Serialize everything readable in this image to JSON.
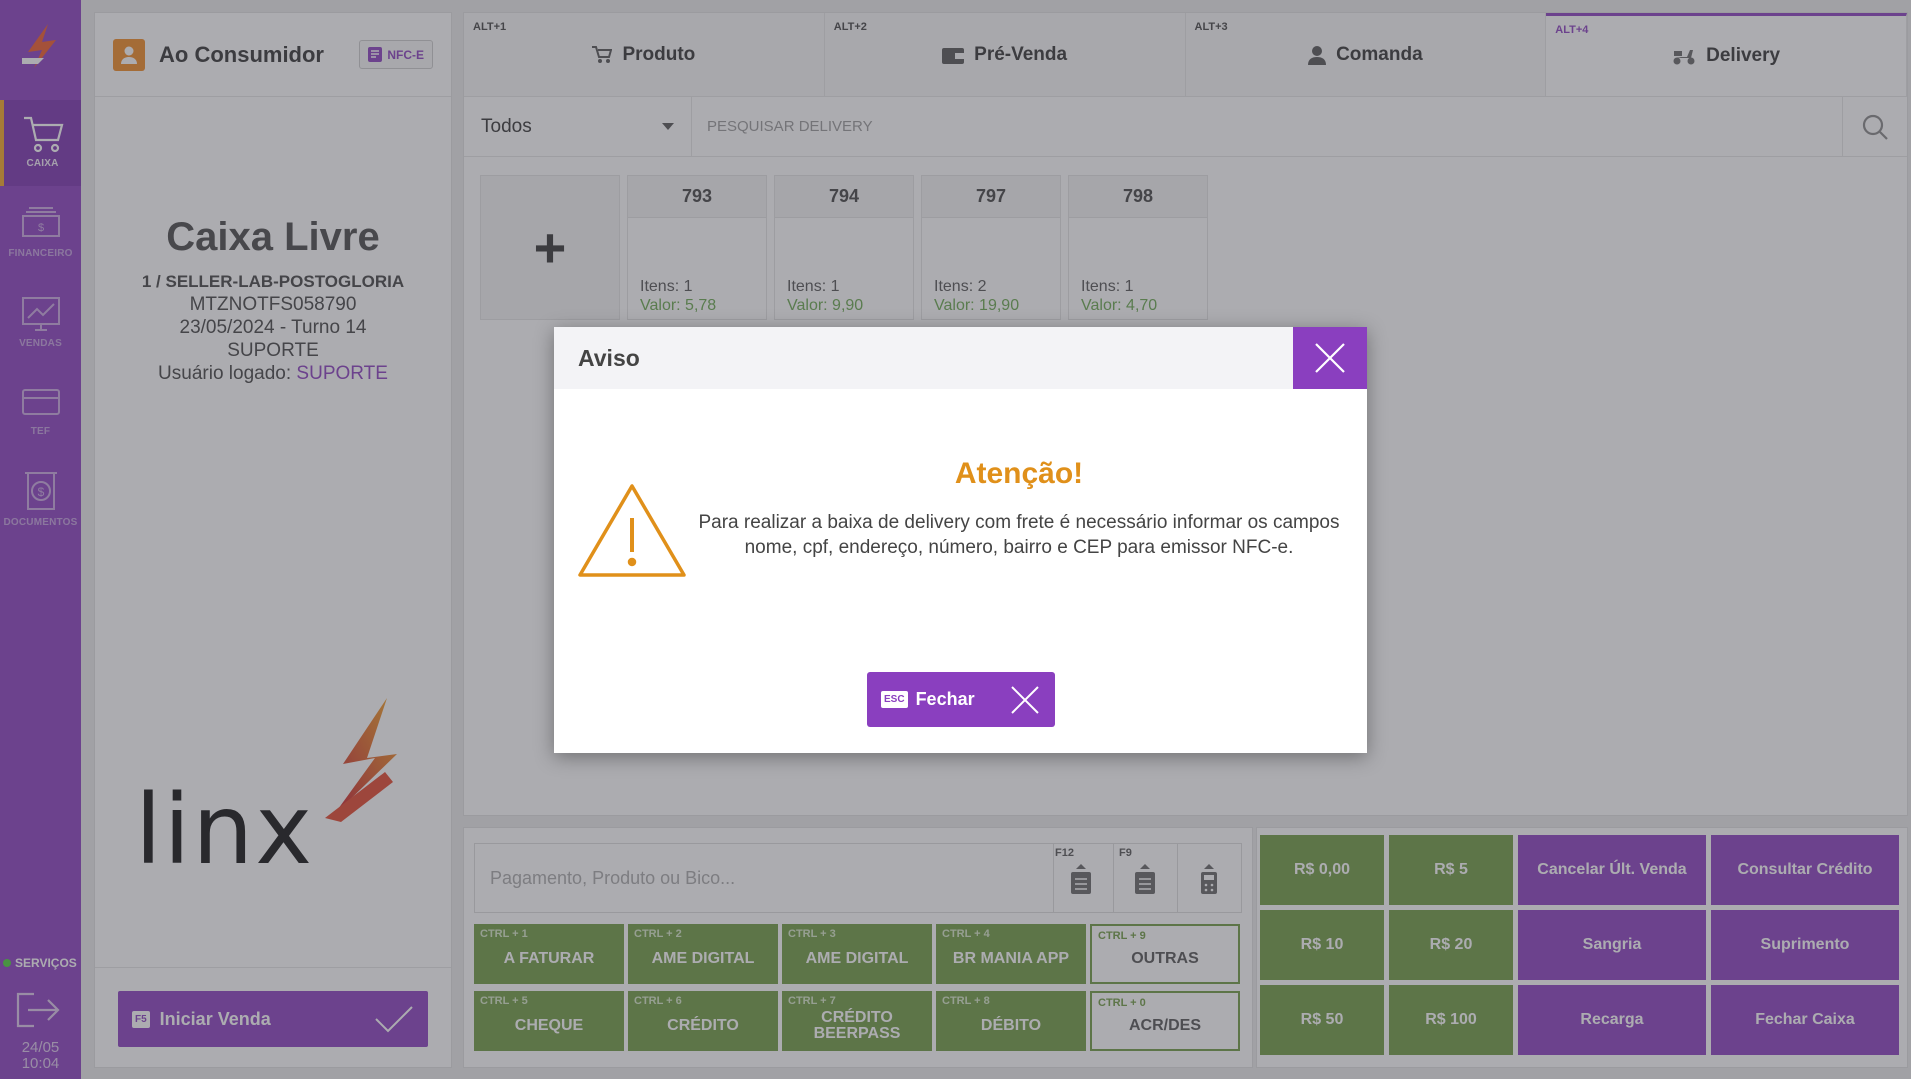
{
  "sidebar": {
    "items": [
      {
        "label": "CAIXA",
        "icon": "cart-icon"
      },
      {
        "label": "FINANCEIRO",
        "icon": "cash-icon"
      },
      {
        "label": "VENDAS",
        "icon": "chart-monitor-icon"
      },
      {
        "label": "TEF",
        "icon": "card-icon"
      },
      {
        "label": "DOCUMENTOS",
        "icon": "document-dollar-icon"
      }
    ],
    "services_label": "SERVIÇOS",
    "date": "24/05",
    "time": "10:04"
  },
  "left_panel": {
    "customer": "Ao Consumidor",
    "nfce_label": "NFC-E",
    "caixa_title": "Caixa Livre",
    "line1": "1 / SELLER-LAB-POSTOGLORIA",
    "line2": "MTZNOTFS058790",
    "line3": "23/05/2024 - Turno 14",
    "line4": "SUPORTE",
    "user_prefix": "Usuário logado:",
    "user_name": "SUPORTE",
    "start_key": "F5",
    "start_label": "Iniciar Venda"
  },
  "tabs": [
    {
      "hotkey": "ALT+1",
      "label": "Produto",
      "icon": "cart-icon"
    },
    {
      "hotkey": "ALT+2",
      "label": "Pré-Venda",
      "icon": "wallet-icon"
    },
    {
      "hotkey": "ALT+3",
      "label": "Comanda",
      "icon": "person-icon"
    },
    {
      "hotkey": "ALT+4",
      "label": "Delivery",
      "icon": "scooter-icon"
    }
  ],
  "filter": {
    "selected": "Todos",
    "search_placeholder": "PESQUISAR DELIVERY"
  },
  "deliveries": [
    {
      "number": "793",
      "items": "Itens: 1",
      "value": "Valor: 5,78"
    },
    {
      "number": "794",
      "items": "Itens: 1",
      "value": "Valor: 9,90"
    },
    {
      "number": "797",
      "items": "Itens: 2",
      "value": "Valor: 19,90"
    },
    {
      "number": "798",
      "items": "Itens: 1",
      "value": "Valor: 4,70"
    }
  ],
  "payment": {
    "input_placeholder": "Pagamento, Produto ou Bico...",
    "f12": "F12",
    "f9": "F9",
    "buttons": [
      {
        "key": "CTRL + 1",
        "label": "A FATURAR"
      },
      {
        "key": "CTRL + 2",
        "label": "AME DIGITAL"
      },
      {
        "key": "CTRL + 3",
        "label": "AME DIGITAL"
      },
      {
        "key": "CTRL + 4",
        "label": "BR MANIA APP"
      },
      {
        "key": "CTRL + 9",
        "label": "OUTRAS"
      },
      {
        "key": "CTRL + 5",
        "label": "CHEQUE"
      },
      {
        "key": "CTRL + 6",
        "label": "CRÉDITO"
      },
      {
        "key": "CTRL + 7",
        "label": "CRÉDITO BEERPASS"
      },
      {
        "key": "CTRL + 8",
        "label": "DÉBITO"
      },
      {
        "key": "CTRL + 0",
        "label": "ACR/DES"
      }
    ]
  },
  "quick": {
    "r0": "R$ 0,00",
    "r5": "R$ 5",
    "r10": "R$ 10",
    "r20": "R$ 20",
    "r50": "R$ 50",
    "r100": "R$ 100",
    "cancel_last": "Cancelar Últ. Venda",
    "consult_credit": "Consultar Crédito",
    "sangria": "Sangria",
    "suprimento": "Suprimento",
    "recarga": "Recarga",
    "fechar_caixa": "Fechar Caixa"
  },
  "modal": {
    "header": "Aviso",
    "title": "Atenção!",
    "message": "Para realizar a baixa de delivery com frete é necessário informar os campos nome, cpf, endereço, número, bairro e CEP para emissor NFC-e.",
    "close_key": "ESC",
    "close_label": "Fechar"
  },
  "colors": {
    "primary": "#8a3fbf",
    "green": "#6f9b43",
    "warning": "#e0901a",
    "accent": "#f08a24"
  }
}
